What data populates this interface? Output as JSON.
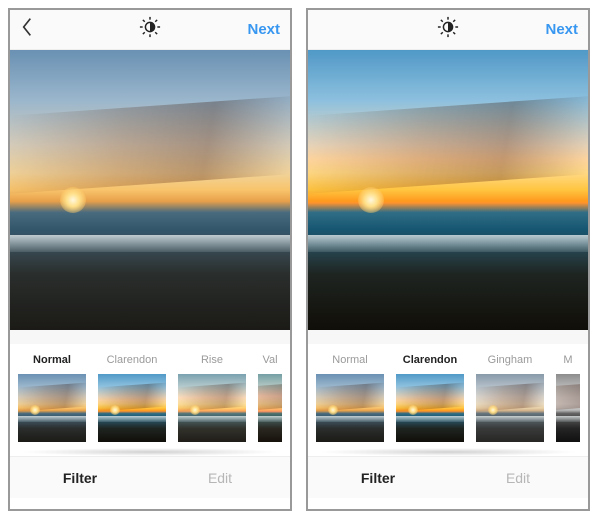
{
  "screens": [
    {
      "header": {
        "next_label": "Next"
      },
      "filters": [
        {
          "label": "Normal",
          "selected": true,
          "style": "normal"
        },
        {
          "label": "Clarendon",
          "selected": false,
          "style": "clarendon"
        },
        {
          "label": "Rise",
          "selected": false,
          "style": "rise"
        },
        {
          "label": "Val",
          "selected": false,
          "style": "valencia",
          "partial": true
        }
      ],
      "tabs": {
        "filter_label": "Filter",
        "edit_label": "Edit",
        "active": "filter"
      },
      "preview_style": "normal"
    },
    {
      "header": {
        "next_label": "Next"
      },
      "filters": [
        {
          "label": "Normal",
          "selected": false,
          "style": "normal"
        },
        {
          "label": "Clarendon",
          "selected": true,
          "style": "clarendon"
        },
        {
          "label": "Gingham",
          "selected": false,
          "style": "gingham"
        },
        {
          "label": "M",
          "selected": false,
          "style": "moon",
          "partial": true
        }
      ],
      "tabs": {
        "filter_label": "Filter",
        "edit_label": "Edit",
        "active": "filter"
      },
      "preview_style": "clarendon"
    }
  ]
}
